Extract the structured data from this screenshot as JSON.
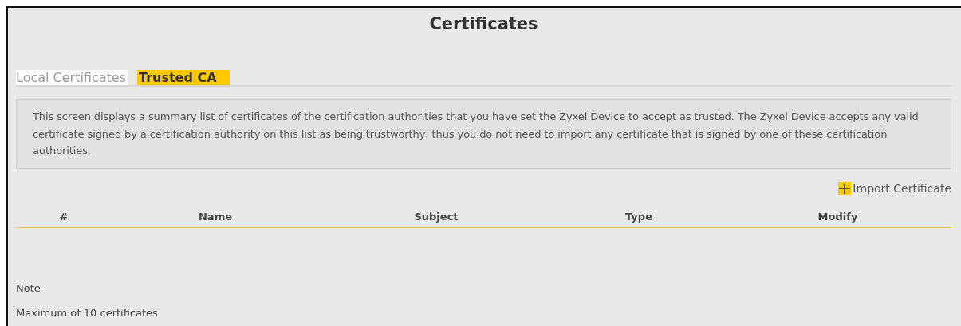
{
  "title": "Certificates",
  "tabs": [
    {
      "label": "Local Certificates",
      "selected": false
    },
    {
      "label": "Trusted CA",
      "selected": true
    }
  ],
  "description": "This screen displays a summary list of certificates of the certification authorities that you have set the Zyxel Device to accept as trusted. The Zyxel Device accepts any valid certificate signed by a certification authority on this list as being trustworthy; thus you do not need to import any certificate that is signed by one of these certification authorities.",
  "import_button": "Import Certificate",
  "table": {
    "columns": [
      "#",
      "Name",
      "Subject",
      "Type",
      "Modify"
    ]
  },
  "note": {
    "heading": "Note",
    "text": "Maximum of 10 certificates"
  }
}
